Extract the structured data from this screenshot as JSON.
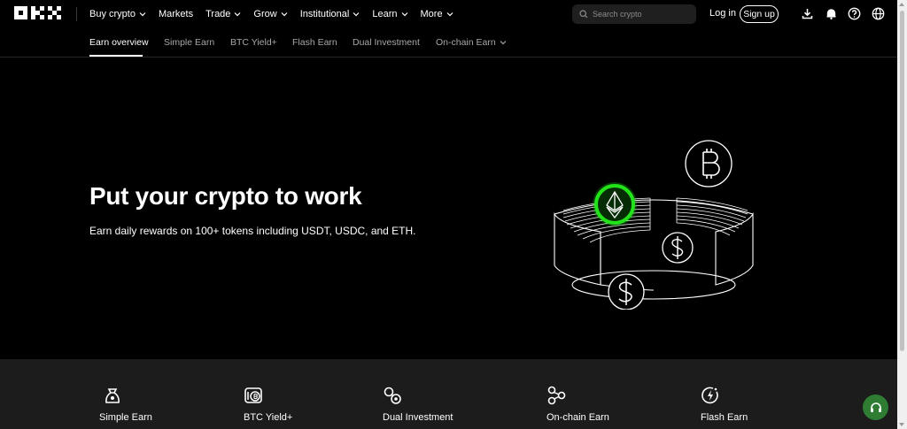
{
  "nav": {
    "menu": [
      {
        "label": "Buy crypto",
        "dropdown": true
      },
      {
        "label": "Markets",
        "dropdown": false
      },
      {
        "label": "Trade",
        "dropdown": true
      },
      {
        "label": "Grow",
        "dropdown": true
      },
      {
        "label": "Institutional",
        "dropdown": true
      },
      {
        "label": "Learn",
        "dropdown": true
      },
      {
        "label": "More",
        "dropdown": true
      }
    ],
    "search_placeholder": "Search crypto",
    "login_label": "Log in",
    "signup_label": "Sign up",
    "icons": [
      "download-icon",
      "bell-icon",
      "help-icon",
      "globe-icon"
    ]
  },
  "subnav": {
    "tabs": [
      {
        "label": "Earn overview",
        "active": true
      },
      {
        "label": "Simple Earn"
      },
      {
        "label": "BTC Yield+"
      },
      {
        "label": "Flash Earn"
      },
      {
        "label": "Dual Investment"
      },
      {
        "label": "On-chain Earn",
        "dropdown": true
      }
    ]
  },
  "hero": {
    "title": "Put your crypto to work",
    "subtitle": "Earn daily rewards on 100+ tokens including USDT, USDC, and ETH."
  },
  "products": [
    {
      "label": "Simple Earn",
      "icon": "money-bag-icon"
    },
    {
      "label": "BTC Yield+",
      "icon": "btc-yield-icon"
    },
    {
      "label": "Dual Investment",
      "icon": "dual-investment-icon"
    },
    {
      "label": "On-chain Earn",
      "icon": "on-chain-icon"
    },
    {
      "label": "Flash Earn",
      "icon": "flash-icon"
    }
  ],
  "colors": {
    "background": "#000000",
    "band": "#1c1c1c",
    "accent_green": "#22e21a",
    "support_button": "#2e7d32"
  }
}
